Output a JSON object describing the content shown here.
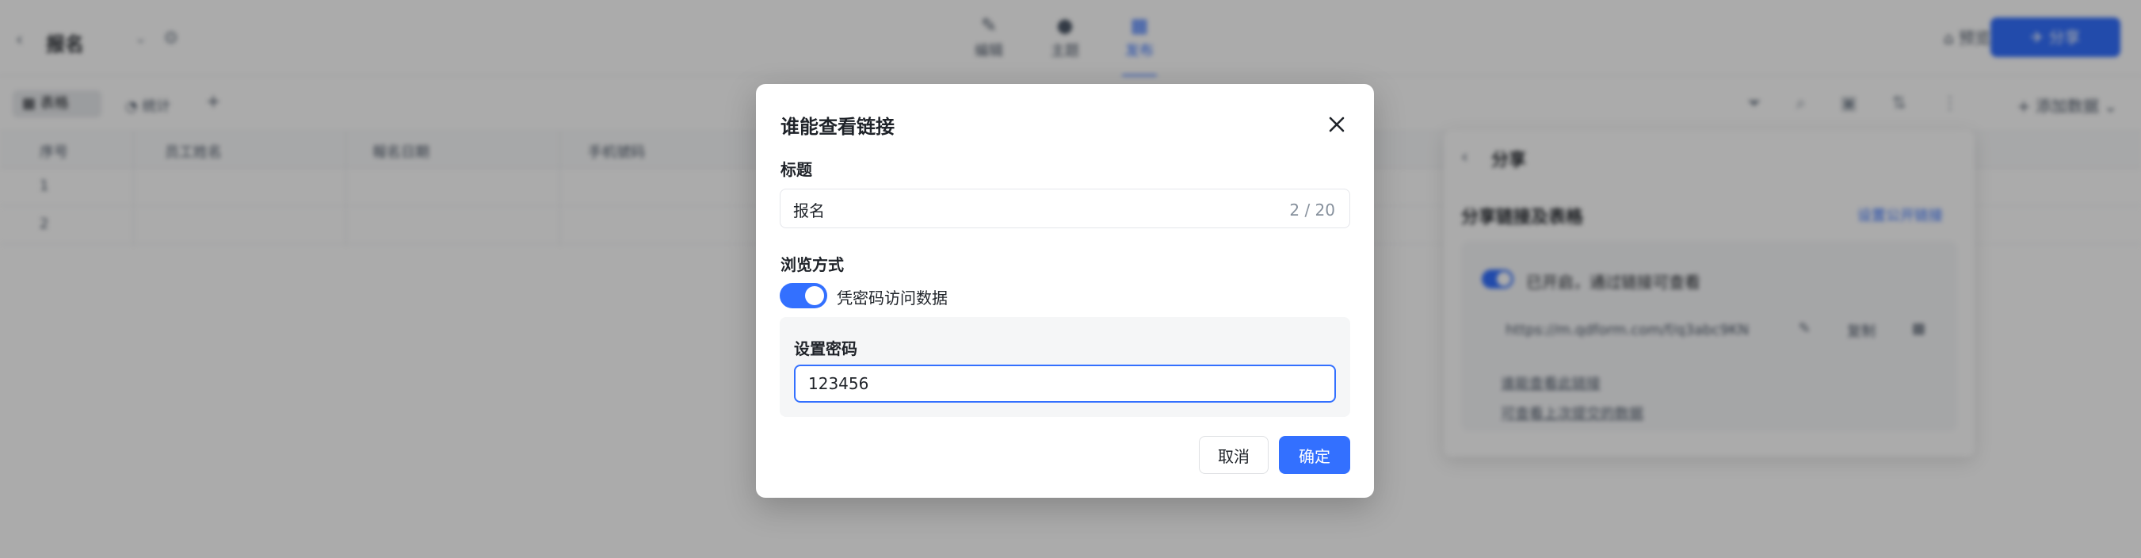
{
  "app": {
    "title": "报名",
    "mode_tabs": [
      {
        "label": "编辑",
        "icon": "pen-icon"
      },
      {
        "label": "主题",
        "icon": "palette-icon"
      },
      {
        "label": "发布",
        "icon": "chart-icon",
        "active": true
      }
    ],
    "preview_label": "预览",
    "publish_label": "分享"
  },
  "toolbar": {
    "view_label": "表格",
    "view2_label": "统计",
    "add_record_label": "添加数据"
  },
  "grid": {
    "columns": [
      "序号",
      "员工姓名",
      "報名日期",
      "手机號码"
    ],
    "rows": [
      "1",
      "2"
    ]
  },
  "side_panel": {
    "title": "分享",
    "heading": "分享链接及表格",
    "link_label": "设置公开链接",
    "status": "已开启，通过链接可查看",
    "url": "https://m.qdform.com/f/q3abc9KN",
    "copy_label": "复制",
    "sub1": "谁能查看此链接",
    "sub2": "可查看上次提交的数据"
  },
  "modal": {
    "title": "谁能查看链接",
    "title_field_label": "标题",
    "title_value": "报名",
    "char_count": "2 / 20",
    "browse_label": "浏览方式",
    "toggle_label": "凭密码访问数据",
    "toggle_on": true,
    "password_label": "设置密码",
    "password_value": "123456",
    "cancel_label": "取消",
    "ok_label": "确定"
  },
  "colors": {
    "accent": "#3370ff",
    "overlay": "rgba(0,0,0,0.33)"
  }
}
